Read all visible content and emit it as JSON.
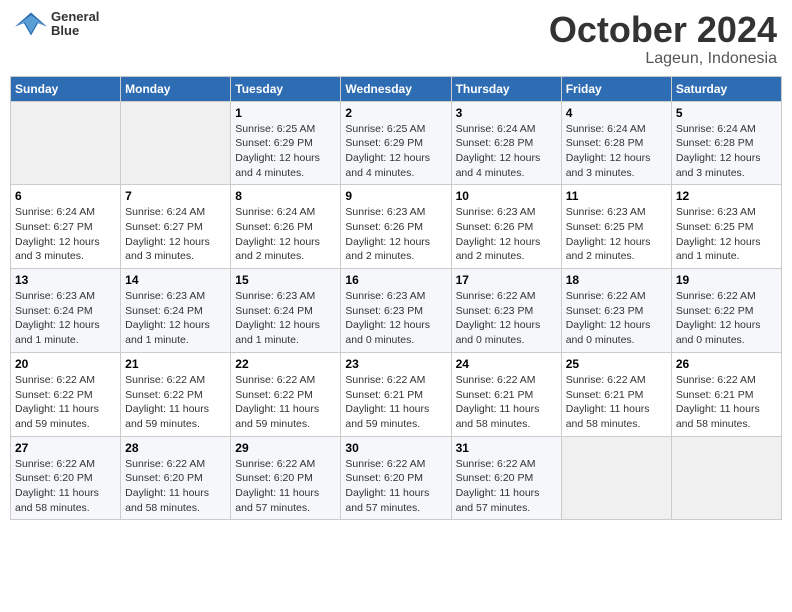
{
  "logo": {
    "line1": "General",
    "line2": "Blue"
  },
  "title": "October 2024",
  "location": "Lageun, Indonesia",
  "weekdays": [
    "Sunday",
    "Monday",
    "Tuesday",
    "Wednesday",
    "Thursday",
    "Friday",
    "Saturday"
  ],
  "weeks": [
    [
      {
        "day": "",
        "info": ""
      },
      {
        "day": "",
        "info": ""
      },
      {
        "day": "1",
        "info": "Sunrise: 6:25 AM\nSunset: 6:29 PM\nDaylight: 12 hours\nand 4 minutes."
      },
      {
        "day": "2",
        "info": "Sunrise: 6:25 AM\nSunset: 6:29 PM\nDaylight: 12 hours\nand 4 minutes."
      },
      {
        "day": "3",
        "info": "Sunrise: 6:24 AM\nSunset: 6:28 PM\nDaylight: 12 hours\nand 4 minutes."
      },
      {
        "day": "4",
        "info": "Sunrise: 6:24 AM\nSunset: 6:28 PM\nDaylight: 12 hours\nand 3 minutes."
      },
      {
        "day": "5",
        "info": "Sunrise: 6:24 AM\nSunset: 6:28 PM\nDaylight: 12 hours\nand 3 minutes."
      }
    ],
    [
      {
        "day": "6",
        "info": "Sunrise: 6:24 AM\nSunset: 6:27 PM\nDaylight: 12 hours\nand 3 minutes."
      },
      {
        "day": "7",
        "info": "Sunrise: 6:24 AM\nSunset: 6:27 PM\nDaylight: 12 hours\nand 3 minutes."
      },
      {
        "day": "8",
        "info": "Sunrise: 6:24 AM\nSunset: 6:26 PM\nDaylight: 12 hours\nand 2 minutes."
      },
      {
        "day": "9",
        "info": "Sunrise: 6:23 AM\nSunset: 6:26 PM\nDaylight: 12 hours\nand 2 minutes."
      },
      {
        "day": "10",
        "info": "Sunrise: 6:23 AM\nSunset: 6:26 PM\nDaylight: 12 hours\nand 2 minutes."
      },
      {
        "day": "11",
        "info": "Sunrise: 6:23 AM\nSunset: 6:25 PM\nDaylight: 12 hours\nand 2 minutes."
      },
      {
        "day": "12",
        "info": "Sunrise: 6:23 AM\nSunset: 6:25 PM\nDaylight: 12 hours\nand 1 minute."
      }
    ],
    [
      {
        "day": "13",
        "info": "Sunrise: 6:23 AM\nSunset: 6:24 PM\nDaylight: 12 hours\nand 1 minute."
      },
      {
        "day": "14",
        "info": "Sunrise: 6:23 AM\nSunset: 6:24 PM\nDaylight: 12 hours\nand 1 minute."
      },
      {
        "day": "15",
        "info": "Sunrise: 6:23 AM\nSunset: 6:24 PM\nDaylight: 12 hours\nand 1 minute."
      },
      {
        "day": "16",
        "info": "Sunrise: 6:23 AM\nSunset: 6:23 PM\nDaylight: 12 hours\nand 0 minutes."
      },
      {
        "day": "17",
        "info": "Sunrise: 6:22 AM\nSunset: 6:23 PM\nDaylight: 12 hours\nand 0 minutes."
      },
      {
        "day": "18",
        "info": "Sunrise: 6:22 AM\nSunset: 6:23 PM\nDaylight: 12 hours\nand 0 minutes."
      },
      {
        "day": "19",
        "info": "Sunrise: 6:22 AM\nSunset: 6:22 PM\nDaylight: 12 hours\nand 0 minutes."
      }
    ],
    [
      {
        "day": "20",
        "info": "Sunrise: 6:22 AM\nSunset: 6:22 PM\nDaylight: 11 hours\nand 59 minutes."
      },
      {
        "day": "21",
        "info": "Sunrise: 6:22 AM\nSunset: 6:22 PM\nDaylight: 11 hours\nand 59 minutes."
      },
      {
        "day": "22",
        "info": "Sunrise: 6:22 AM\nSunset: 6:22 PM\nDaylight: 11 hours\nand 59 minutes."
      },
      {
        "day": "23",
        "info": "Sunrise: 6:22 AM\nSunset: 6:21 PM\nDaylight: 11 hours\nand 59 minutes."
      },
      {
        "day": "24",
        "info": "Sunrise: 6:22 AM\nSunset: 6:21 PM\nDaylight: 11 hours\nand 58 minutes."
      },
      {
        "day": "25",
        "info": "Sunrise: 6:22 AM\nSunset: 6:21 PM\nDaylight: 11 hours\nand 58 minutes."
      },
      {
        "day": "26",
        "info": "Sunrise: 6:22 AM\nSunset: 6:21 PM\nDaylight: 11 hours\nand 58 minutes."
      }
    ],
    [
      {
        "day": "27",
        "info": "Sunrise: 6:22 AM\nSunset: 6:20 PM\nDaylight: 11 hours\nand 58 minutes."
      },
      {
        "day": "28",
        "info": "Sunrise: 6:22 AM\nSunset: 6:20 PM\nDaylight: 11 hours\nand 58 minutes."
      },
      {
        "day": "29",
        "info": "Sunrise: 6:22 AM\nSunset: 6:20 PM\nDaylight: 11 hours\nand 57 minutes."
      },
      {
        "day": "30",
        "info": "Sunrise: 6:22 AM\nSunset: 6:20 PM\nDaylight: 11 hours\nand 57 minutes."
      },
      {
        "day": "31",
        "info": "Sunrise: 6:22 AM\nSunset: 6:20 PM\nDaylight: 11 hours\nand 57 minutes."
      },
      {
        "day": "",
        "info": ""
      },
      {
        "day": "",
        "info": ""
      }
    ]
  ]
}
